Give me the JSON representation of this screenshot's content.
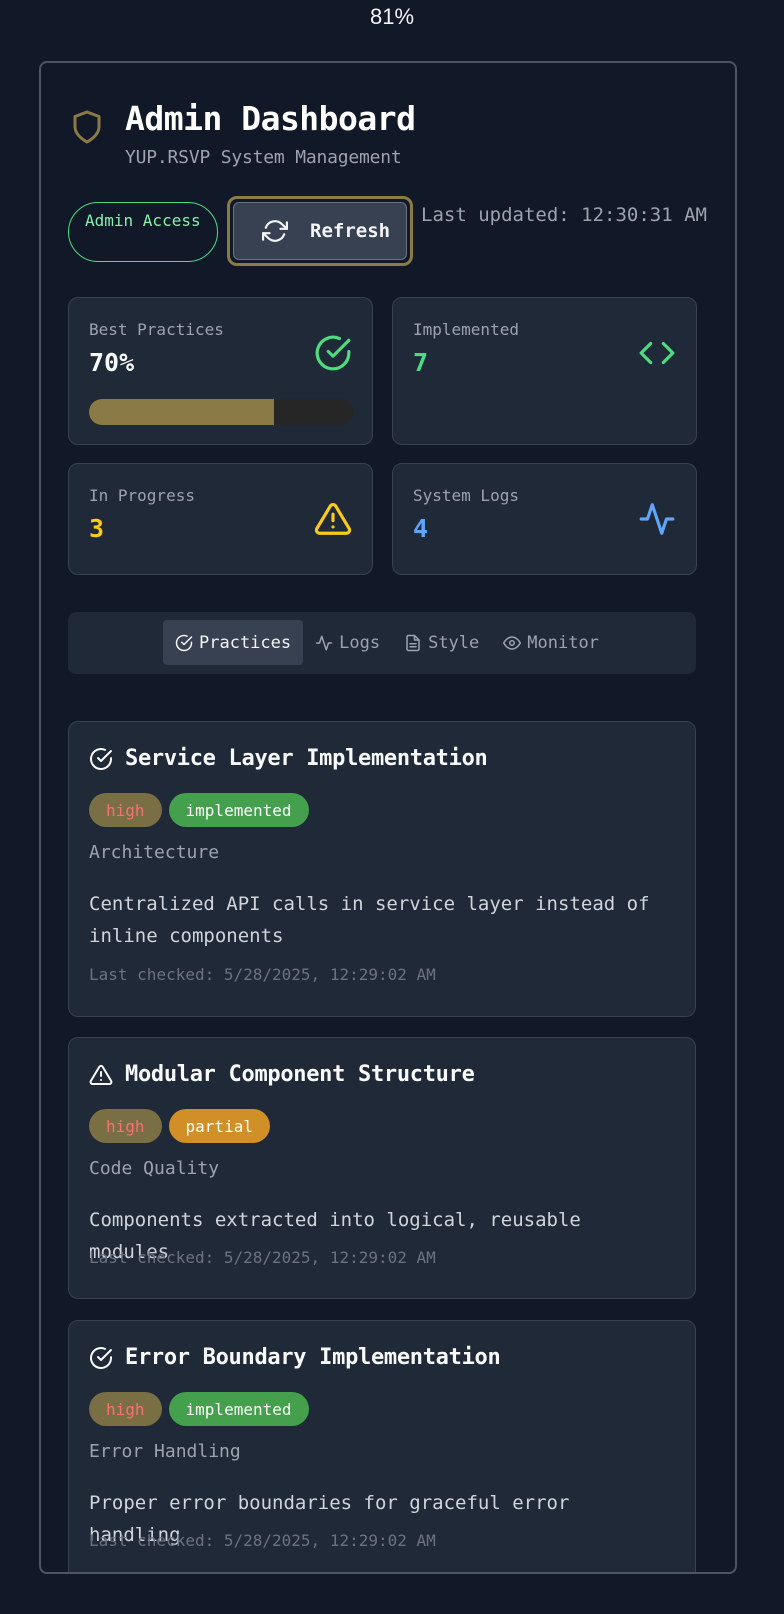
{
  "zoom": "81%",
  "header": {
    "title": "Admin Dashboard",
    "subtitle": "YUP.RSVP System Management",
    "admin_badge": "Admin Access",
    "refresh_label": "Refresh",
    "last_updated": "Last updated: 12:30:31 AM"
  },
  "stats": {
    "best_practices": {
      "label": "Best Practices",
      "value": "70%",
      "progress": 0.7,
      "color": "#f9fafb"
    },
    "implemented": {
      "label": "Implemented",
      "value": "7",
      "color": "#4ade80"
    },
    "in_progress": {
      "label": "In Progress",
      "value": "3",
      "color": "#facc15"
    },
    "system_logs": {
      "label": "System Logs",
      "value": "4",
      "color": "#60a5fa"
    }
  },
  "tabs": [
    {
      "label": "Practices",
      "icon": "check-circle-icon",
      "active": true
    },
    {
      "label": "Logs",
      "icon": "activity-icon",
      "active": false
    },
    {
      "label": "Style",
      "icon": "file-text-icon",
      "active": false
    },
    {
      "label": "Monitor",
      "icon": "eye-icon",
      "active": false
    }
  ],
  "practices": [
    {
      "title": "Service Layer Implementation",
      "icon": "check-circle-icon",
      "priority": "high",
      "status": "implemented",
      "category": "Architecture",
      "description": "Centralized API calls in service layer instead of inline components",
      "last_checked": "Last checked: 5/28/2025, 12:29:02 AM"
    },
    {
      "title": "Modular Component Structure",
      "icon": "warning-triangle-icon",
      "priority": "high",
      "status": "partial",
      "category": "Code Quality",
      "description": "Components extracted into logical, reusable modules",
      "last_checked": "Last checked: 5/28/2025, 12:29:02 AM"
    },
    {
      "title": "Error Boundary Implementation",
      "icon": "check-circle-icon",
      "priority": "high",
      "status": "implemented",
      "category": "Error Handling",
      "description": "Proper error boundaries for graceful error handling",
      "last_checked": "Last checked: 5/28/2025, 12:29:02 AM"
    }
  ],
  "colors": {
    "background": "#111827",
    "card": "#1f2937",
    "accent_gold": "#8a7a45",
    "success": "#4ade80",
    "warning": "#facc15",
    "info": "#60a5fa"
  }
}
